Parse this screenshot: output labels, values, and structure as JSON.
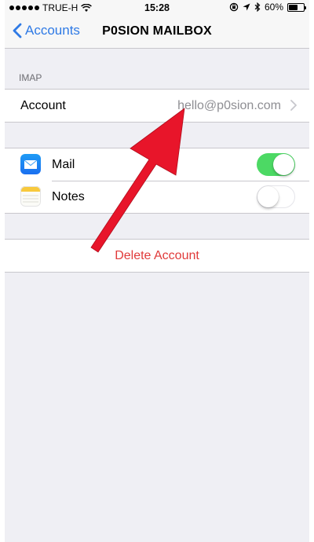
{
  "status_bar": {
    "carrier": "TRUE-H",
    "time": "15:28",
    "battery": "60%",
    "battery_level": 0.6
  },
  "nav": {
    "back_label": "Accounts",
    "title": "P0SION MAILBOX"
  },
  "imap_section": {
    "header": "IMAP",
    "account_label": "Account",
    "account_value": "hello@p0sion.com"
  },
  "apps": [
    {
      "label": "Mail",
      "icon": "mail-icon",
      "enabled": true
    },
    {
      "label": "Notes",
      "icon": "notes-icon",
      "enabled": false
    }
  ],
  "delete_label": "Delete Account",
  "colors": {
    "accent": "#2f7ae5",
    "toggle_on": "#4cd964",
    "destructive": "#e03a3a",
    "annotation": "#e8152a"
  }
}
